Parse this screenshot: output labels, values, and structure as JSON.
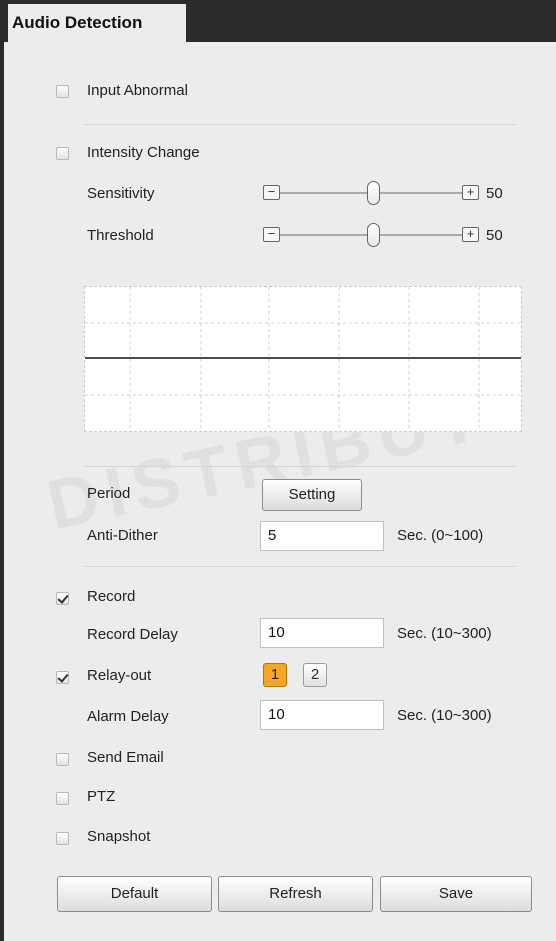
{
  "panel": {
    "title": "Audio Detection"
  },
  "input_abnormal": {
    "label": "Input Abnormal",
    "checked": false
  },
  "intensity_change": {
    "label": "Intensity Change",
    "checked": false
  },
  "sensitivity": {
    "label": "Sensitivity",
    "value": "50",
    "minus": "−",
    "plus": "+",
    "level_fraction": 0.5
  },
  "threshold": {
    "label": "Threshold",
    "value": "50",
    "minus": "−",
    "plus": "+",
    "level_fraction": 0.5
  },
  "period": {
    "label": "Period",
    "button": "Setting"
  },
  "anti_dither": {
    "label": "Anti-Dither",
    "value": "5",
    "range": "Sec. (0~100)"
  },
  "record": {
    "label": "Record",
    "checked": true
  },
  "record_delay": {
    "label": "Record Delay",
    "value": "10",
    "range": "Sec. (10~300)"
  },
  "relay_out": {
    "label": "Relay-out",
    "checked": true,
    "channels": [
      "1",
      "2"
    ],
    "selected": "1"
  },
  "alarm_delay": {
    "label": "Alarm Delay",
    "value": "10",
    "range": "Sec. (10~300)"
  },
  "send_email": {
    "label": "Send Email",
    "checked": false
  },
  "ptz": {
    "label": "PTZ",
    "checked": false
  },
  "snapshot": {
    "label": "Snapshot",
    "checked": false
  },
  "buttons": {
    "default": "Default",
    "refresh": "Refresh",
    "save": "Save"
  },
  "colors": {
    "accent": "#f5a623",
    "title_bar": "#2b2b2b",
    "panel_bg": "#ececec"
  }
}
